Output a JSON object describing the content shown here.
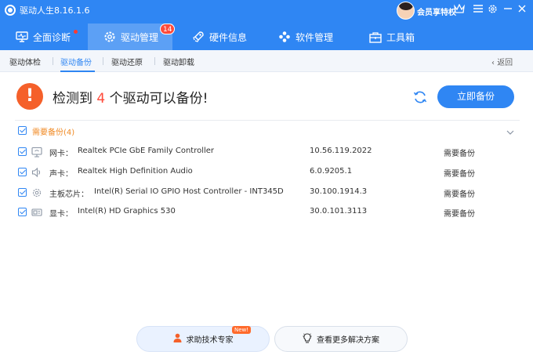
{
  "app": {
    "title": "驱动人生8.16.1.6"
  },
  "user": {
    "vip_label": "会员享特权"
  },
  "window_icons": [
    "vip-crown-icon",
    "menu-icon",
    "gear-icon",
    "minimize-icon",
    "close-icon"
  ],
  "main_tabs": [
    {
      "label": "全面诊断",
      "icon": "monitor-icon",
      "dot": true
    },
    {
      "label": "驱动管理",
      "icon": "gear-icon",
      "badge": "14",
      "active": true
    },
    {
      "label": "硬件信息",
      "icon": "rocket-icon"
    },
    {
      "label": "软件管理",
      "icon": "apps-icon"
    },
    {
      "label": "工具箱",
      "icon": "toolbox-icon"
    }
  ],
  "sub_tabs": [
    {
      "label": "驱动体检"
    },
    {
      "label": "驱动备份",
      "active": true
    },
    {
      "label": "驱动还原"
    },
    {
      "label": "驱动卸载"
    }
  ],
  "back_label": "返回",
  "summary": {
    "prefix": "检测到 ",
    "count": "4",
    "suffix": " 个驱动可以备份!"
  },
  "backup_button": "立即备份",
  "group": {
    "label": "需要备份(4)"
  },
  "drivers": [
    {
      "icon": "network-card-icon",
      "category": "网卡：",
      "name": "Realtek PCIe GbE Family Controller",
      "version": "10.56.119.2022",
      "status": "需要备份"
    },
    {
      "icon": "speaker-icon",
      "category": "声卡：",
      "name": "Realtek High Definition Audio",
      "version": "6.0.9205.1",
      "status": "需要备份"
    },
    {
      "icon": "chipset-icon",
      "category": "主板芯片：",
      "name": "Intel(R) Serial IO GPIO Host Controller - INT345D",
      "version": "30.100.1914.3",
      "status": "需要备份"
    },
    {
      "icon": "display-card-icon",
      "category": "显卡：",
      "name": "Intel(R) HD Graphics 530",
      "version": "30.0.101.3113",
      "status": "需要备份"
    }
  ],
  "bottom": {
    "help_label": "求助技术专家",
    "new_badge": "New!",
    "more_label": "查看更多解决方案"
  },
  "colors": {
    "accent": "#2f86f3",
    "warning": "#f5602a",
    "group": "#f08a24",
    "count": "#ff4a3a"
  }
}
